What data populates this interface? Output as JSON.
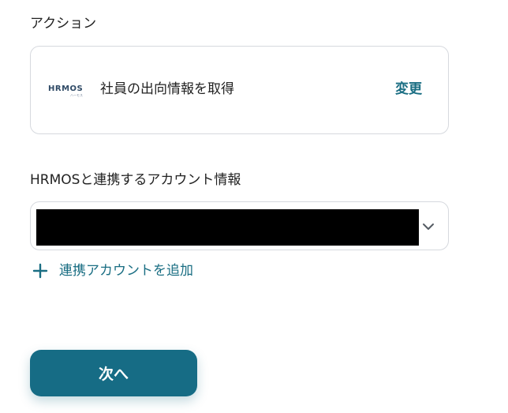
{
  "action_section": {
    "label": "アクション",
    "app_logo_text": "HRMOS",
    "app_logo_subtext": "ハーモス",
    "action_name": "社員の出向情報を取得",
    "change_label": "変更"
  },
  "account_section": {
    "label": "HRMOSと連携するアカウント情報",
    "selected_value": "",
    "chevron_icon": "chevron-down-icon",
    "add_account_label": "連携アカウントを追加",
    "add_icon": "plus-icon"
  },
  "footer": {
    "next_label": "次へ"
  },
  "colors": {
    "accent": "#1a6e83",
    "button_bg": "#166c85",
    "border": "#d6d9de",
    "text": "#222222"
  }
}
